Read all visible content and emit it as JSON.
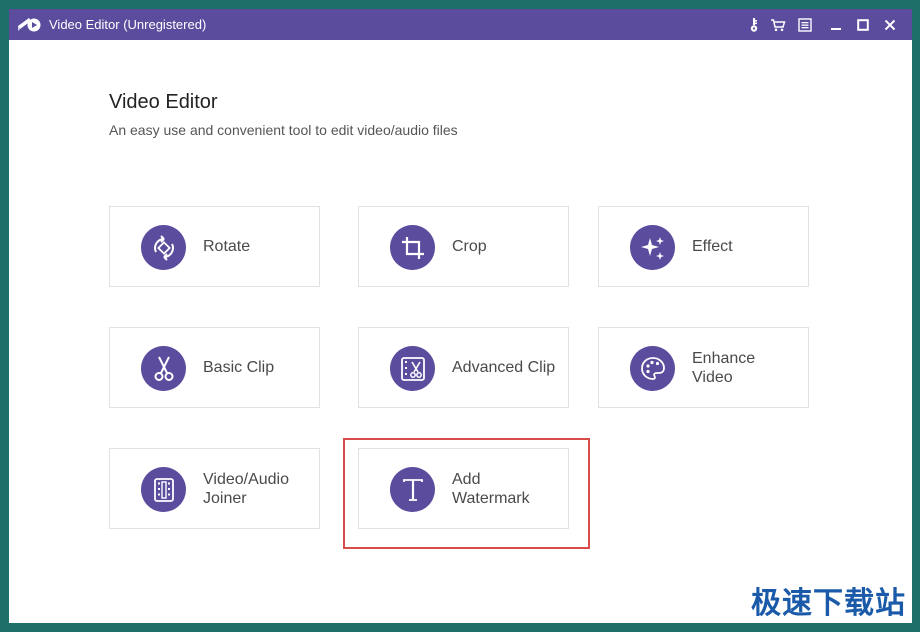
{
  "titlebar": {
    "title": "Video Editor (Unregistered)",
    "buttons": [
      "key-icon",
      "cart-icon",
      "menu-icon",
      "minimize-icon",
      "maximize-icon",
      "close-icon"
    ]
  },
  "header": {
    "title": "Video Editor",
    "subtitle": "An easy use and convenient tool to edit video/audio files"
  },
  "tools": [
    {
      "label": "Rotate",
      "icon": "rotate-icon"
    },
    {
      "label": "Crop",
      "icon": "crop-icon"
    },
    {
      "label": "Effect",
      "icon": "effect-icon"
    },
    {
      "label": "Basic Clip",
      "icon": "scissors-icon"
    },
    {
      "label": "Advanced Clip",
      "icon": "advanced-clip-icon"
    },
    {
      "label": "Enhance\nVideo",
      "icon": "palette-icon"
    },
    {
      "label": "Video/Audio\nJoiner",
      "icon": "film-icon"
    },
    {
      "label": "Add\nWatermark",
      "icon": "text-t-icon"
    }
  ],
  "highlighted_tool": "Add Watermark",
  "watermark": "极速下载站",
  "colors": {
    "accent": "#5b4c9e",
    "background": "#1e6e6a",
    "highlight": "#d94c4c",
    "watermark": "#1a5aa8"
  }
}
